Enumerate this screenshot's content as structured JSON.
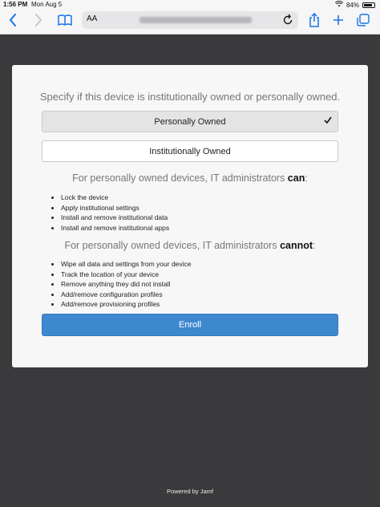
{
  "status_bar": {
    "time": "1:56 PM",
    "date": "Mon Aug 5",
    "battery": "84%"
  },
  "browser": {
    "reader_label": "AA"
  },
  "page": {
    "heading": "Specify if this device is institutionally owned or personally owned.",
    "options": [
      {
        "label": "Personally Owned",
        "selected": true
      },
      {
        "label": "Institutionally Owned",
        "selected": false
      }
    ],
    "can": {
      "prefix": "For personally owned devices, IT administrators ",
      "keyword": "can",
      "suffix": ":",
      "items": [
        "Lock the device",
        "Apply institutional settings",
        "Install and remove institutional data",
        "Install and remove institutional apps"
      ]
    },
    "cannot": {
      "prefix": "For personally owned devices, IT administrators ",
      "keyword": "cannot",
      "suffix": ":",
      "items": [
        "Wipe all data and settings from your device",
        "Track the location of your device",
        "Remove anything they did not install",
        "Add/remove configuration profiles",
        "Add/remove provisioning profiles"
      ]
    },
    "enroll_label": "Enroll",
    "footer": "Powered by Jamf"
  }
}
